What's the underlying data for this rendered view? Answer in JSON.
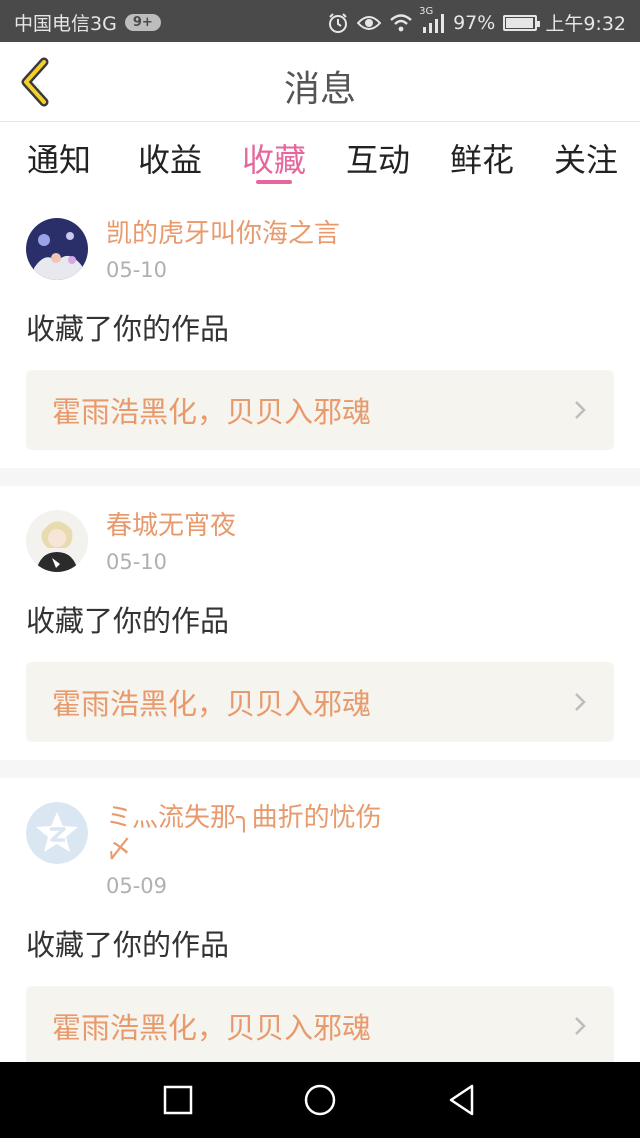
{
  "status_bar": {
    "carrier": "中国电信3G",
    "notification_badge": "9+",
    "network_label": "3G",
    "battery": "97%",
    "battery_level": 0.97,
    "time": "上午9:32",
    "icons": [
      "alarm-icon",
      "eye-icon",
      "wifi-icon",
      "signal-icon",
      "battery-icon"
    ]
  },
  "header": {
    "title": "消息",
    "back_icon": "chevron-left-icon"
  },
  "tabs": [
    {
      "label": "通知",
      "active": false
    },
    {
      "label": "收益",
      "active": false
    },
    {
      "label": "收藏",
      "active": true
    },
    {
      "label": "互动",
      "active": false
    },
    {
      "label": "鲜花",
      "active": false
    },
    {
      "label": "关注",
      "active": false
    }
  ],
  "colors": {
    "accent": "#e6679d",
    "username": "#e89a6c",
    "card_link_bg": "#f5f4ee"
  },
  "messages": [
    {
      "username": "凯的虎牙叫你海之言",
      "date": "05-10",
      "action": "收藏了你的作品",
      "work_title": "霍雨浩黑化，贝贝入邪魂"
    },
    {
      "username": "春城无宵夜",
      "date": "05-10",
      "action": "收藏了你的作品",
      "work_title": "霍雨浩黑化，贝贝入邪魂"
    },
    {
      "username": "ミ灬流失那╮曲折的忧伤〆",
      "date": "05-09",
      "action": "收藏了你的作品",
      "work_title": "霍雨浩黑化，贝贝入邪魂"
    }
  ],
  "nav_bar": {
    "buttons": [
      "recents-square-icon",
      "home-circle-icon",
      "back-triangle-icon"
    ]
  }
}
